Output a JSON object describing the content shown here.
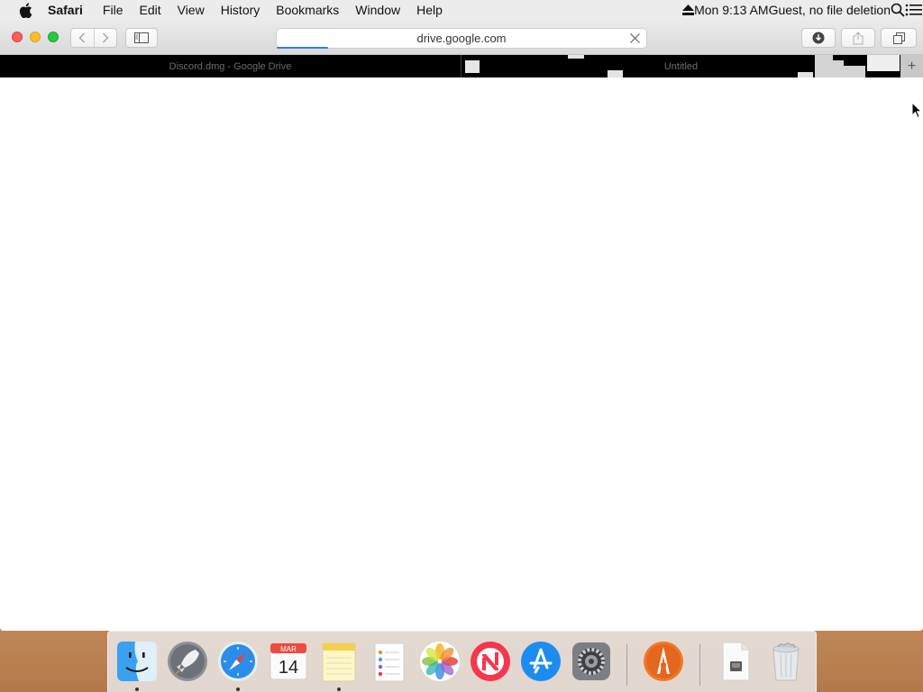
{
  "menubar": {
    "app_name": "Safari",
    "items": [
      "File",
      "Edit",
      "View",
      "History",
      "Bookmarks",
      "Window",
      "Help"
    ],
    "clock": "Mon 9:13 AM",
    "user": "Guest, no file deletion"
  },
  "toolbar": {
    "address": "drive.google.com",
    "load_progress": 0.14
  },
  "tabs": [
    {
      "title": "Discord.dmg - Google Drive",
      "active": false
    },
    {
      "title": "Untitled",
      "active": true
    }
  ],
  "new_tab_label": "+",
  "calendar": {
    "month": "MAR",
    "day": "14"
  },
  "dock": {
    "items": [
      {
        "name": "Finder",
        "icon": "finder-icon",
        "running": true
      },
      {
        "name": "Launchpad",
        "icon": "launchpad-icon",
        "running": false
      },
      {
        "name": "Safari",
        "icon": "safari-icon",
        "running": true
      },
      {
        "name": "Calendar",
        "icon": "calendar-icon",
        "running": false
      },
      {
        "name": "Notes",
        "icon": "notes-icon",
        "running": true
      },
      {
        "name": "Reminders",
        "icon": "reminders-icon",
        "running": false
      },
      {
        "name": "Photos",
        "icon": "photos-icon",
        "running": false
      },
      {
        "name": "News",
        "icon": "news-icon",
        "running": false
      },
      {
        "name": "App Store",
        "icon": "app-store-icon",
        "running": false
      },
      {
        "name": "System Preferences",
        "icon": "system-preferences-icon",
        "running": false
      },
      {
        "name": "Git Tower",
        "icon": "tower-icon",
        "running": false
      },
      {
        "name": "Document",
        "icon": "document-icon",
        "running": false
      },
      {
        "name": "Trash",
        "icon": "trash-icon",
        "running": false
      }
    ]
  },
  "colors": {
    "menubar_bg": "#ececec",
    "tabbar_bg": "#000000",
    "progress": "#2f7fe0",
    "close": "#fc5f57",
    "minimize": "#fdbc2e",
    "zoom": "#28c840"
  }
}
